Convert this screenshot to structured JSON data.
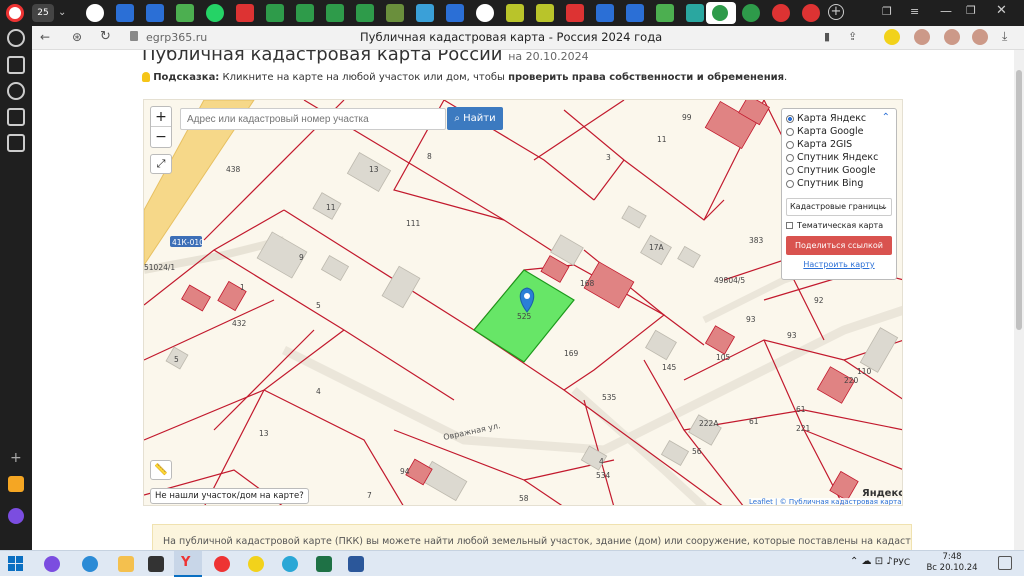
{
  "browser": {
    "tab_count_badge": "25",
    "url": "egrp365.ru",
    "page_title": "Публичная кадастровая карта - Россия 2024 года"
  },
  "header": {
    "title": "Публичная кадастровая карта России",
    "date": "на 20.10.2024",
    "hint_label": "Подсказка:",
    "hint_text": " Кликните на карте на любой участок или дом, чтобы ",
    "hint_bold": "проверить права собственности и обременения",
    "hint_end": "."
  },
  "map": {
    "search_placeholder": "Адрес или кадастровый номер участка",
    "search_button": "Найти",
    "zoom_in": "+",
    "zoom_out": "−",
    "layers": [
      {
        "label": "Карта Яндекс",
        "selected": true
      },
      {
        "label": "Карта Google",
        "selected": false
      },
      {
        "label": "Карта 2GIS",
        "selected": false
      },
      {
        "label": "Спутник Яндекс",
        "selected": false
      },
      {
        "label": "Спутник Google",
        "selected": false
      },
      {
        "label": "Спутник Bing",
        "selected": false
      }
    ],
    "boundaries_select": "Кадастровые границы",
    "thematic_label": "Тематическая карта",
    "share_button": "Поделиться ссылкой",
    "configure_link": "Настроить карту",
    "not_found_button": "Не нашли участок/дом на карте?",
    "attribution": "Leaflet | © Публичная кадастровая карта, ©",
    "yandex_logo": "Яндекс",
    "road_label": "41К-010",
    "street_label": "Овражная ул.",
    "parcel_labels": [
      "8",
      "3",
      "11",
      "13",
      "11",
      "111",
      "9",
      "5",
      "432",
      "4",
      "13",
      "5",
      "525",
      "168",
      "169",
      "17А",
      "383",
      "92",
      "93",
      "93",
      "105",
      "145",
      "535",
      "222А",
      "56",
      "61",
      "61",
      "221",
      "110",
      "220",
      "4",
      "534",
      "94",
      "58",
      "7",
      "1",
      "99",
      "438",
      "51024/1",
      "49804/5"
    ]
  },
  "info_box": {
    "text": "На публичной кадастровой карте (ПКК) вы можете найти любой земельный участок, здание (дом) или сооружение, которые поставлены на кадастровый учёт в Едином"
  },
  "taskbar": {
    "lang": "РУС",
    "time": "7:48",
    "date": "Вс 20.10.24"
  }
}
